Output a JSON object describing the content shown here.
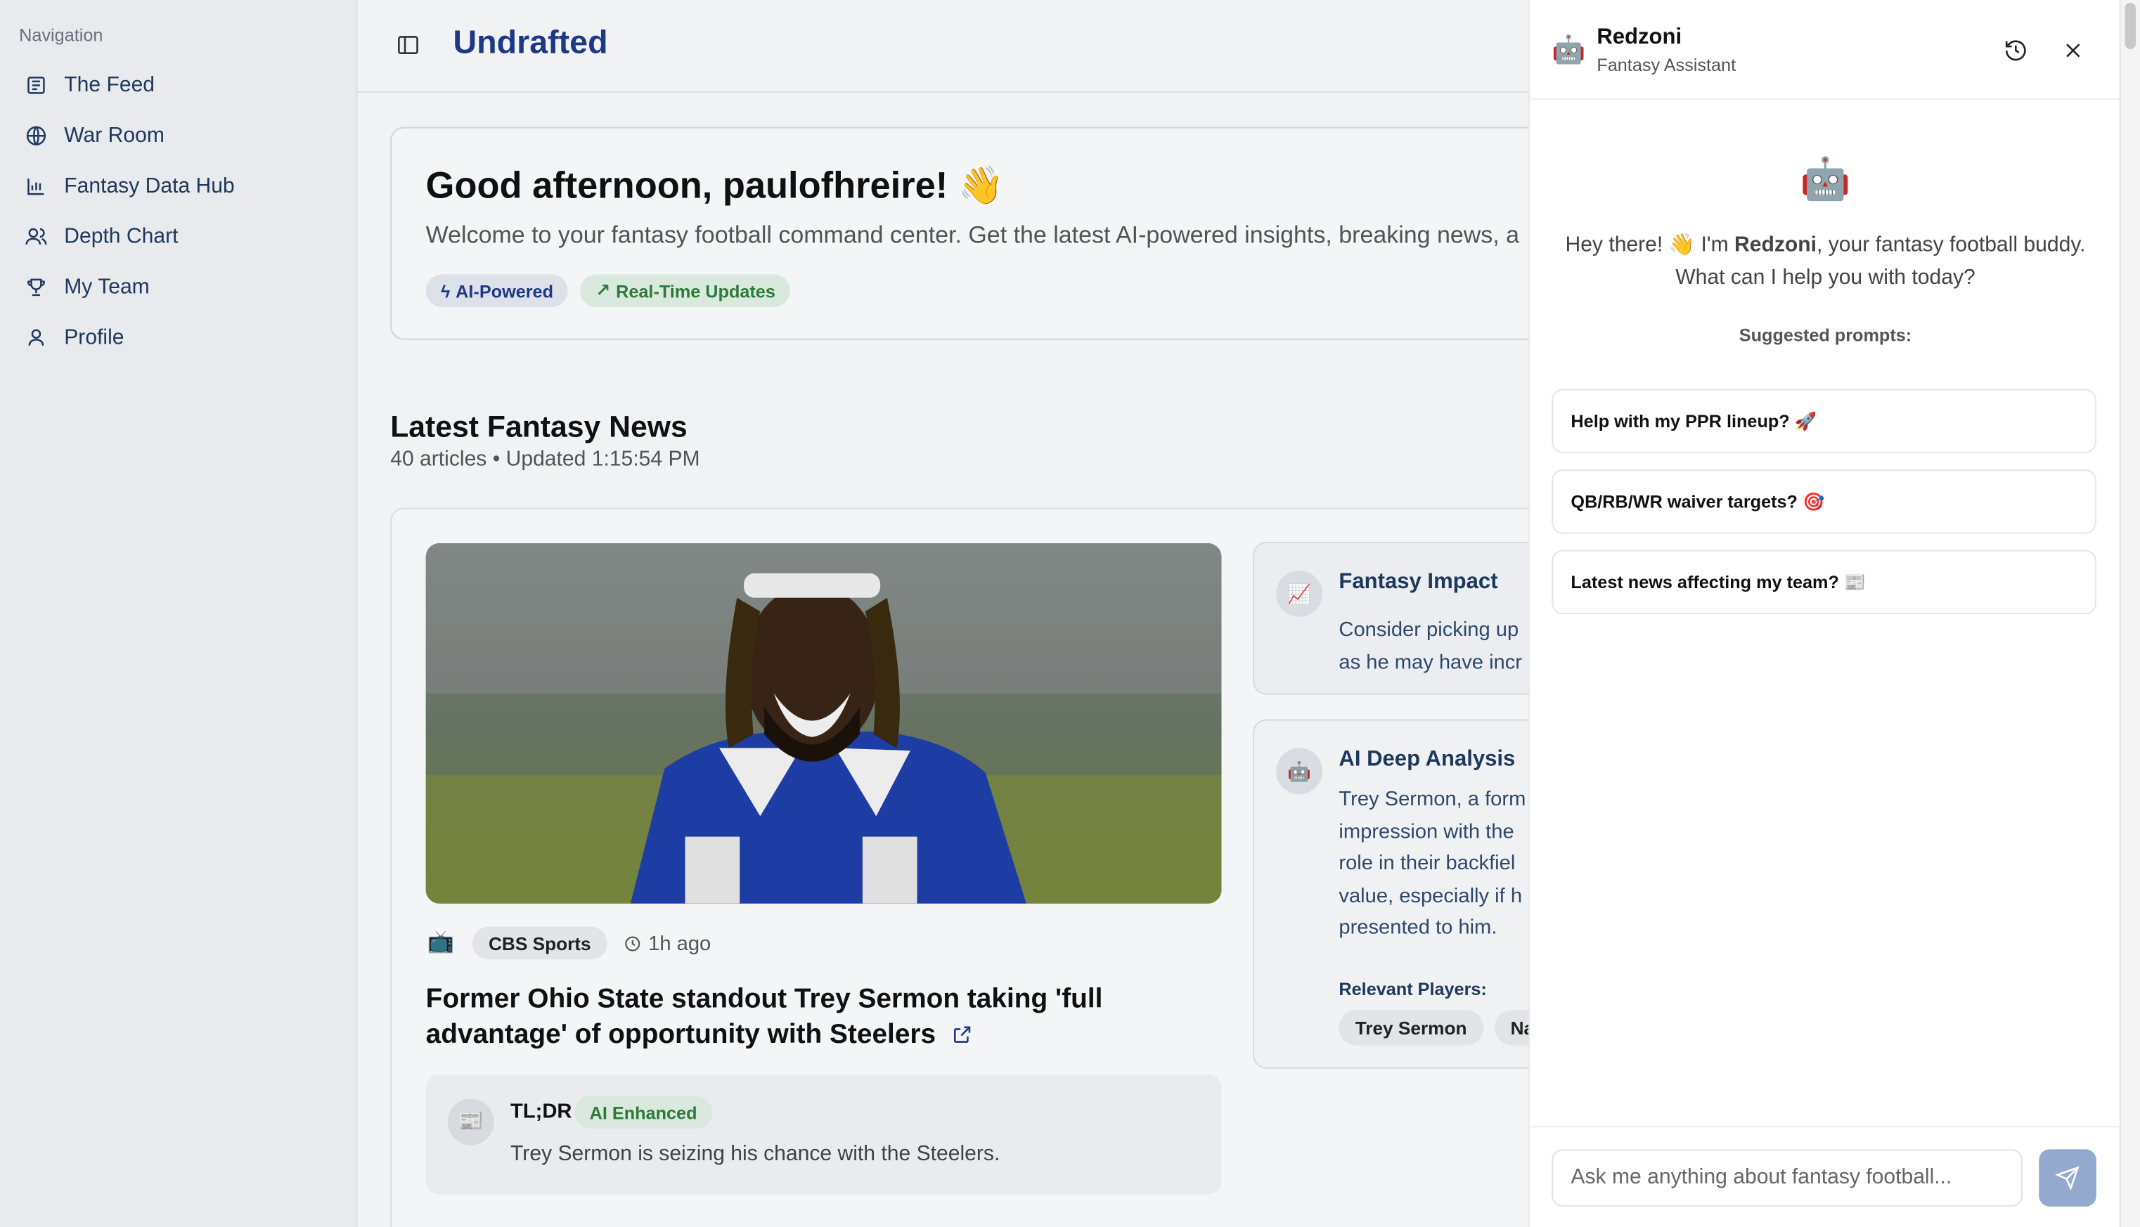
{
  "sidebar": {
    "heading": "Navigation",
    "items": [
      {
        "label": "The Feed",
        "icon": "newspaper-icon"
      },
      {
        "label": "War Room",
        "icon": "globe-icon"
      },
      {
        "label": "Fantasy Data Hub",
        "icon": "bar-chart-icon"
      },
      {
        "label": "Depth Chart",
        "icon": "users-icon"
      },
      {
        "label": "My Team",
        "icon": "trophy-icon"
      },
      {
        "label": "Profile",
        "icon": "user-icon"
      }
    ]
  },
  "header": {
    "brand": "Undrafted"
  },
  "welcome": {
    "title": "Good afternoon, paulofhreire! 👋",
    "subtitle": "Welcome to your fantasy football command center. Get the latest AI-powered insights, breaking news, a",
    "badge_ai": "AI-Powered",
    "badge_rt": "Real-Time Updates"
  },
  "news": {
    "title": "Latest Fantasy News",
    "subtitle": "40 articles • Updated 1:15:54 PM",
    "article": {
      "source_icon": "📺",
      "source": "CBS Sports",
      "time": "1h ago",
      "headline": "Former Ohio State standout Trey Sermon taking 'full advantage' of opportunity with Steelers",
      "tldr_label": "TL;DR",
      "tldr_badge": "AI Enhanced",
      "tldr_text": "Trey Sermon is seizing his chance with the Steelers."
    },
    "impact": {
      "icon": "📈",
      "title": "Fantasy Impact",
      "line1": "Consider picking up",
      "line2": "as he may have incr"
    },
    "analysis": {
      "icon": "🤖",
      "title": "AI Deep Analysis",
      "lines": [
        "Trey Sermon, a form",
        "impression with the",
        "role in their backfiel",
        "value, especially if h",
        "presented to him."
      ],
      "relevant_label": "Relevant Players:",
      "players": [
        "Trey Sermon",
        "Naje"
      ]
    }
  },
  "assistant": {
    "icon": "🤖",
    "name": "Redzoni",
    "role": "Fantasy Assistant",
    "greeting_pre": "Hey there! 👋 I'm ",
    "greeting_name": "Redzoni",
    "greeting_post": ", your fantasy football buddy. What can I help you with today?",
    "suggested_label": "Suggested prompts:",
    "prompts": [
      "Help with my PPR lineup? 🚀",
      "QB/RB/WR waiver targets? 🎯",
      "Latest news affecting my team? 📰"
    ],
    "input_placeholder": "Ask me anything about fantasy football..."
  }
}
